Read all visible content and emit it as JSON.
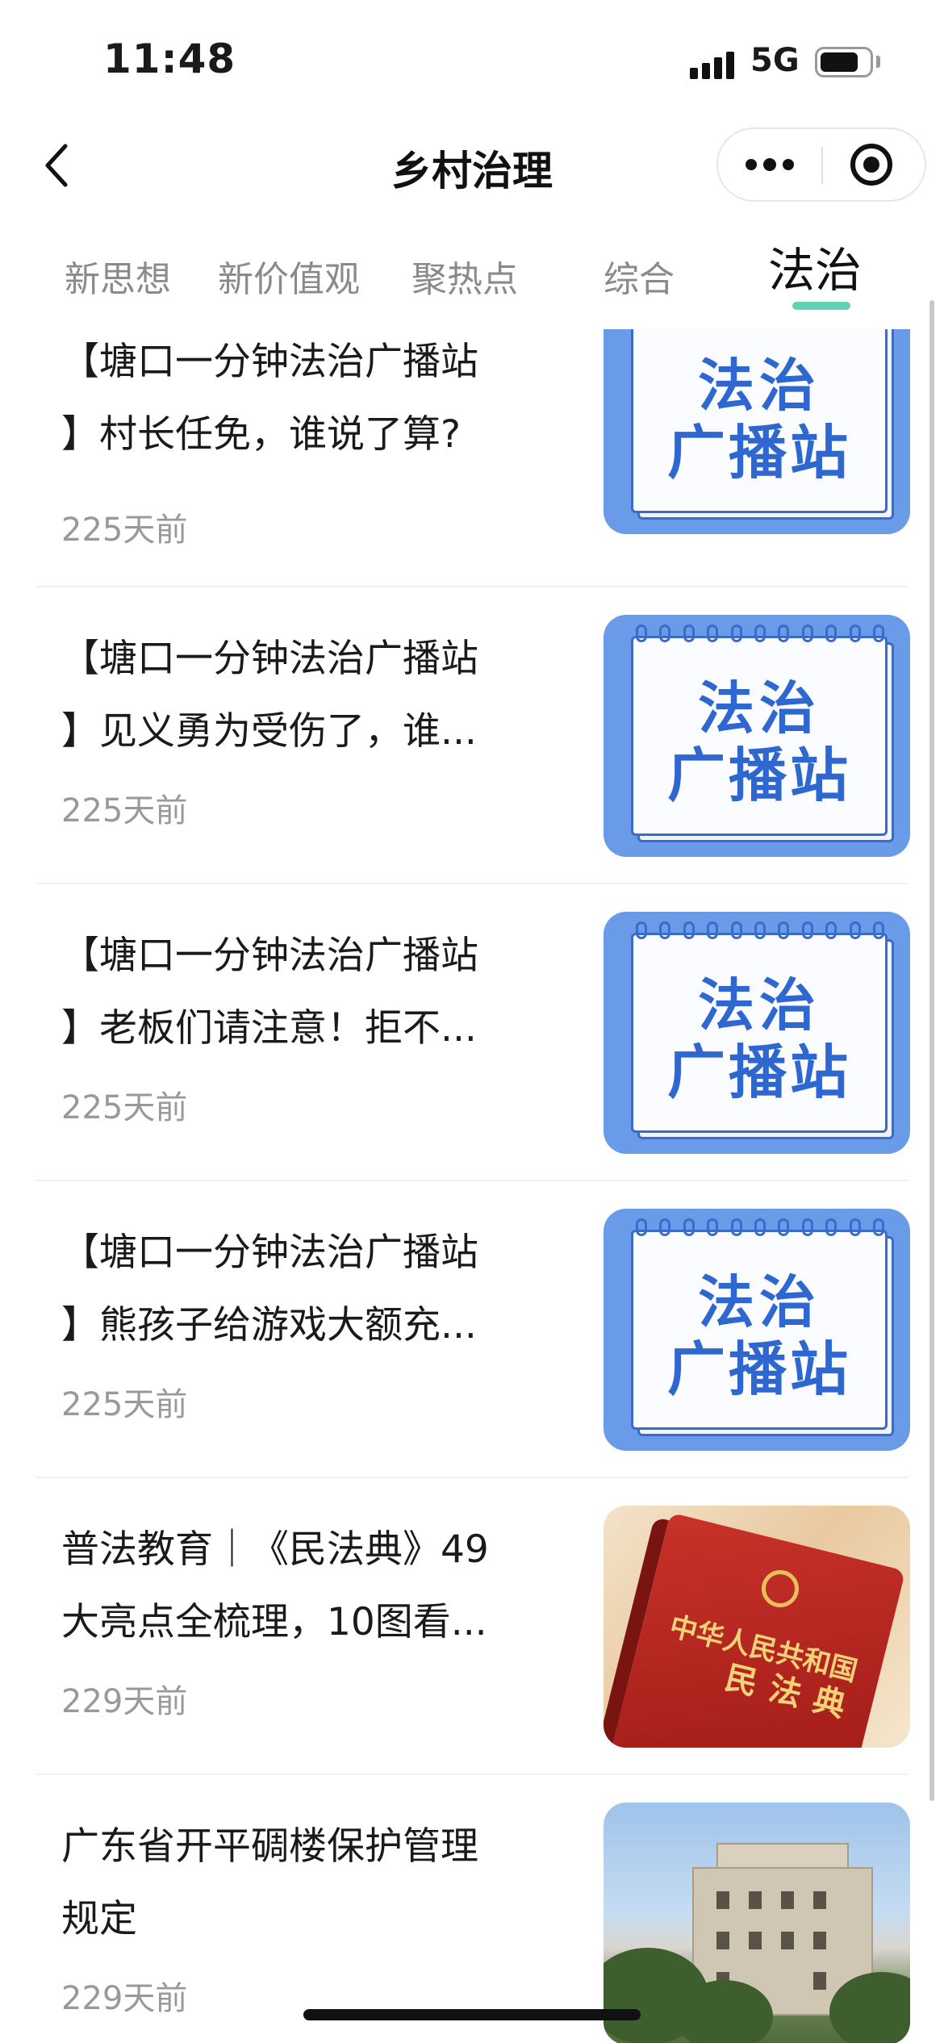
{
  "status_bar": {
    "time": "11:48",
    "network": "5G",
    "icons": [
      "signal-icon",
      "battery-icon"
    ]
  },
  "nav": {
    "title": "乡村治理",
    "back_icon": "chevron-left-icon",
    "capsule_icons": [
      "more-icon",
      "target-icon"
    ]
  },
  "tabs": [
    {
      "label": "新思想",
      "active": false
    },
    {
      "label": "新价值观",
      "active": false
    },
    {
      "label": "聚热点",
      "active": false
    },
    {
      "label": "综合",
      "active": false
    },
    {
      "label": "法治",
      "active": true
    }
  ],
  "colors": {
    "accent": "#5fd3b3",
    "legal_thumb_bg": "#6a9be8",
    "legal_text": "#2f67d0"
  },
  "articles": [
    {
      "title_l1": "【塘口一分钟法治广播站",
      "title_l2": "】村长任免，谁说了算?",
      "date": "225天前",
      "thumb": "legal",
      "thumb_t1": "法治",
      "thumb_t2": "广播站"
    },
    {
      "title_l1": "【塘口一分钟法治广播站",
      "title_l2": "】见义勇为受伤了，谁...",
      "date": "225天前",
      "thumb": "legal",
      "thumb_t1": "法治",
      "thumb_t2": "广播站"
    },
    {
      "title_l1": "【塘口一分钟法治广播站",
      "title_l2": "】老板们请注意！拒不...",
      "date": "225天前",
      "thumb": "legal",
      "thumb_t1": "法治",
      "thumb_t2": "广播站"
    },
    {
      "title_l1": "【塘口一分钟法治广播站",
      "title_l2": "】熊孩子给游戏大额充...",
      "date": "225天前",
      "thumb": "legal",
      "thumb_t1": "法治",
      "thumb_t2": "广播站"
    },
    {
      "title_l1": "普法教育｜《民法典》49",
      "title_l2": "大亮点全梳理，10图看...",
      "date": "229天前",
      "thumb": "code",
      "thumb_t1": "中华人民共和国",
      "thumb_t2": "民法典"
    },
    {
      "title_l1": "广东省开平碉楼保护管理",
      "title_l2": "规定",
      "date": "229天前",
      "thumb": "photo"
    }
  ]
}
